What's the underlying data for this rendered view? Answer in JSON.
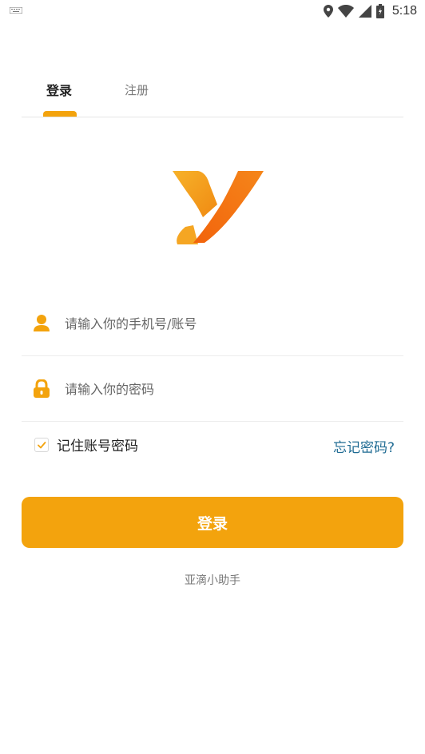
{
  "status_bar": {
    "time": "5:18",
    "icons": [
      "keyboard-icon",
      "location-icon",
      "wifi-icon",
      "signal-icon",
      "battery-icon"
    ]
  },
  "tabs": [
    {
      "label": "登录",
      "active": true
    },
    {
      "label": "注册",
      "active": false
    }
  ],
  "form": {
    "account_placeholder": "请输入你的手机号/账号",
    "password_placeholder": "请输入你的密码",
    "remember_label": "记住账号密码",
    "remember_checked": true,
    "forgot_label": "忘记密码?",
    "login_button": "登录"
  },
  "footer": {
    "app_name": "亚滴小助手"
  },
  "colors": {
    "accent": "#f3a30d",
    "link": "#1f6b93",
    "logo_light": "#f5a623",
    "logo_dark": "#f26a10"
  }
}
